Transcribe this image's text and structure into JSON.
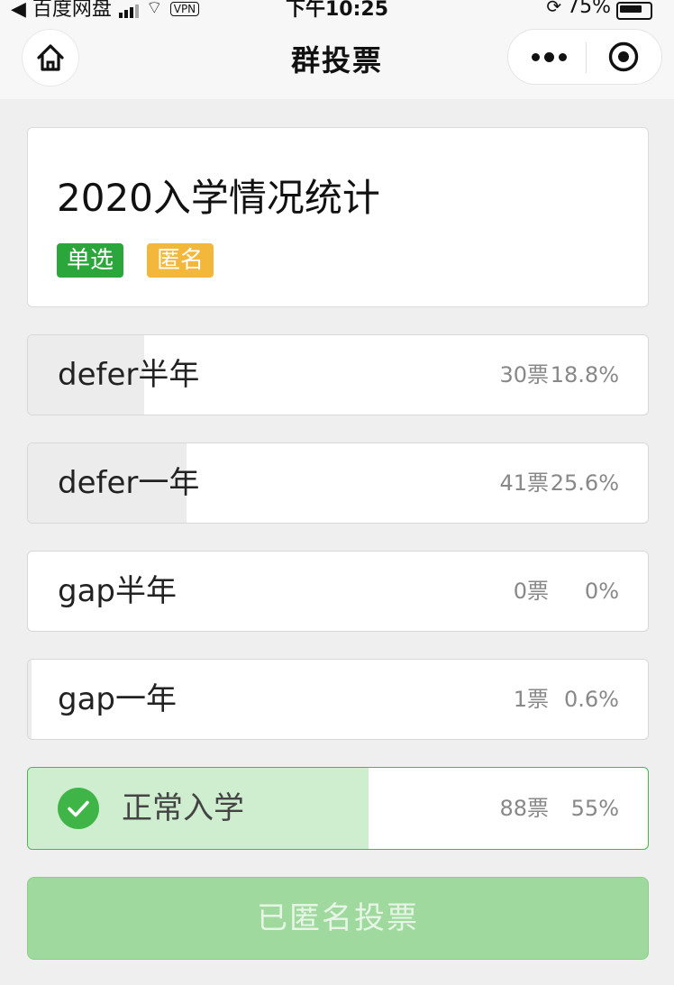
{
  "status_bar": {
    "back_app": "◀ 百度网盘",
    "vpn": "VPN",
    "time": "下午10:25",
    "battery": "75%"
  },
  "nav": {
    "title": "群投票"
  },
  "poll": {
    "title": "2020入学情况统计",
    "tags": {
      "single": "单选",
      "anonymous": "匿名"
    },
    "options": [
      {
        "label": "defer半年",
        "votes": "30票",
        "percent": "18.8%",
        "fraction": 0.188,
        "selected": false
      },
      {
        "label": "defer一年",
        "votes": "41票",
        "percent": "25.6%",
        "fraction": 0.256,
        "selected": false
      },
      {
        "label": "gap半年",
        "votes": "0票",
        "percent": "0%",
        "fraction": 0,
        "selected": false
      },
      {
        "label": "gap一年",
        "votes": "1票",
        "percent": "0.6%",
        "fraction": 0.006,
        "selected": false
      },
      {
        "label": "正常入学",
        "votes": "88票",
        "percent": "55%",
        "fraction": 0.55,
        "selected": true
      }
    ]
  },
  "submit": {
    "label": "已匿名投票"
  },
  "colors": {
    "accent_green": "#2aa63b",
    "tag_yellow": "#f3b73b",
    "selected_fill": "#cfedcf",
    "button_green": "#9fd99d"
  },
  "icons": {
    "home": "home-icon",
    "more": "more-dots-icon",
    "close": "target-close-icon",
    "check": "check-circle-icon"
  }
}
